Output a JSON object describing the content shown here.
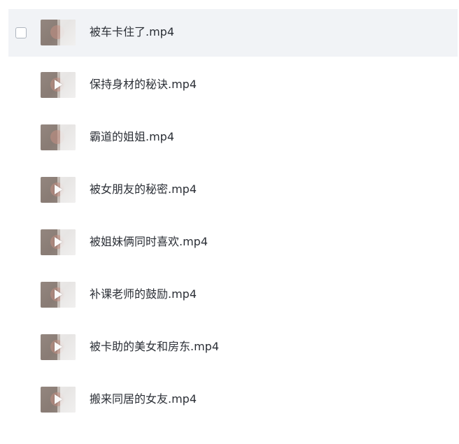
{
  "files": [
    {
      "name": "被车卡住了.mp4",
      "selected": true,
      "thumbnail": "video-thumbnail"
    },
    {
      "name": "保持身材的秘诀.mp4",
      "selected": false,
      "thumbnail": "video-thumbnail"
    },
    {
      "name": "霸道的姐姐.mp4",
      "selected": false,
      "thumbnail": "video-thumbnail"
    },
    {
      "name": "被女朋友的秘密.mp4",
      "selected": false,
      "thumbnail": "video-thumbnail"
    },
    {
      "name": "被姐妹俩同时喜欢.mp4",
      "selected": false,
      "thumbnail": "video-thumbnail"
    },
    {
      "name": "补课老师的鼓励.mp4",
      "selected": false,
      "thumbnail": "video-thumbnail"
    },
    {
      "name": "被卡助的美女和房东.mp4",
      "selected": false,
      "thumbnail": "video-thumbnail"
    },
    {
      "name": "搬来同居的女友.mp4",
      "selected": false,
      "thumbnail": "video-thumbnail"
    }
  ],
  "colors": {
    "selected_row_bg": "#f1f3f6",
    "text": "#2b2f36",
    "checkbox_border": "#aeb5bf"
  },
  "icons": {
    "checkbox": "checkbox-icon",
    "play": "play-icon"
  }
}
